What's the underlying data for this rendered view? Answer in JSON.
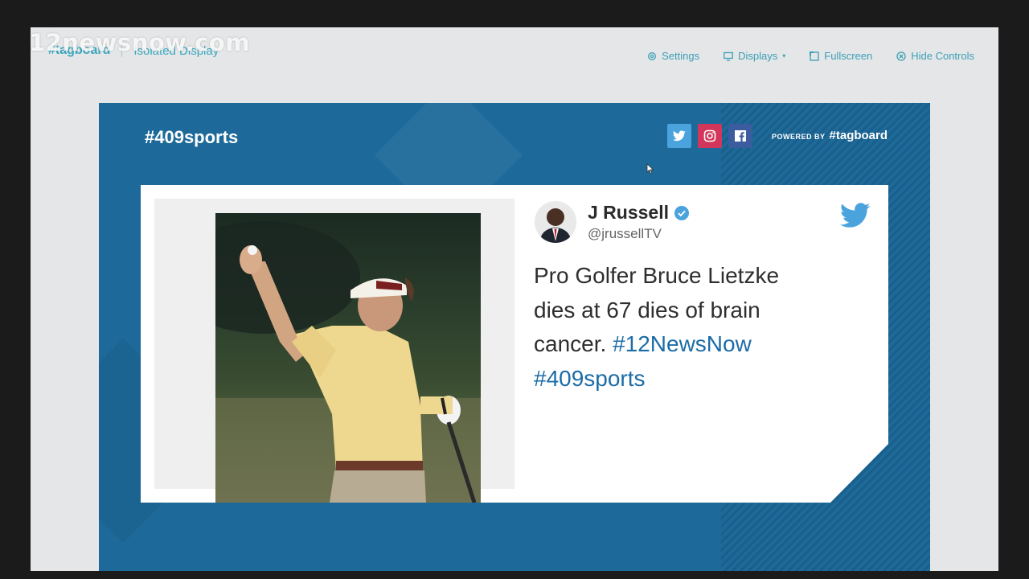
{
  "watermark": "12newsnow.com",
  "app": {
    "logo": "#tagboard",
    "section": "Isolated Display"
  },
  "controls": [
    {
      "label": "Settings",
      "icon": "gear-icon"
    },
    {
      "label": "Displays",
      "icon": "monitor-icon"
    },
    {
      "label": "Fullscreen",
      "icon": "expand-icon"
    },
    {
      "label": "Hide Controls",
      "icon": "close-circle-icon"
    }
  ],
  "display": {
    "hashtag": "#409sports",
    "social": [
      "twitter-icon",
      "instagram-icon",
      "facebook-icon"
    ],
    "powered_by": "POWERED BY",
    "powered_logo": "#tagboard"
  },
  "post": {
    "author_name": "J Russell",
    "author_handle": "@jrussellTV",
    "verified": true,
    "text_plain": "Pro Golfer Bruce Lietzke dies at 67 dies of brain cancer.",
    "hashtag_1": "#12NewsNow",
    "hashtag_2": "#409sports",
    "image": "golfer-waving-ball-photo"
  },
  "colors": {
    "brand_teal": "#39a9c1",
    "display_blue": "#1d6a9a",
    "hashtag_blue": "#1b6ca7",
    "twitter_blue": "#4aa3dc",
    "instagram_pink": "#d2365b",
    "facebook_navy": "#3b5c9e"
  }
}
